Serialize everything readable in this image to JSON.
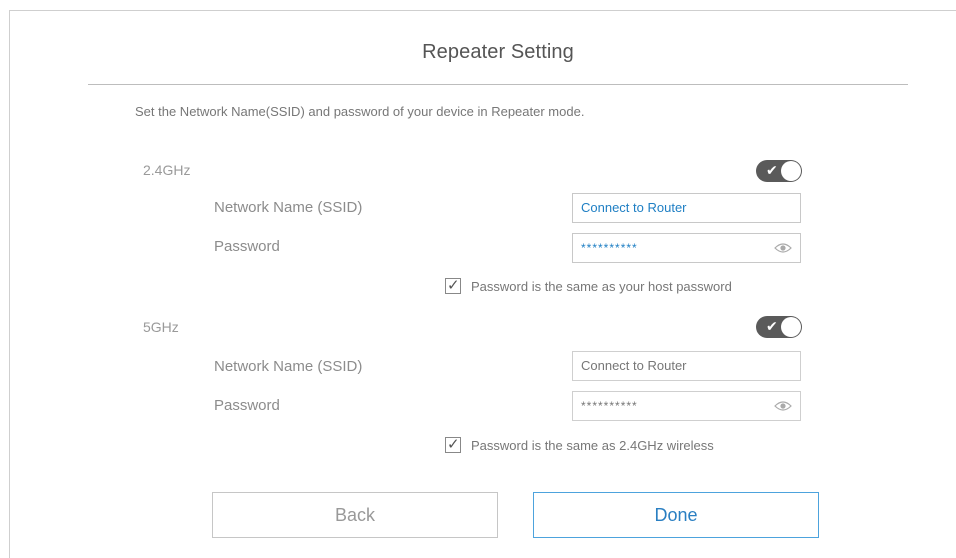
{
  "title": "Repeater Setting",
  "description": "Set the Network  Name(SSID) and password of your device in Repeater mode.",
  "bands": [
    {
      "name": "2.4GHz",
      "enabled": true,
      "ssid_label": "Network Name (SSID)",
      "ssid_value": "Connect to Router",
      "password_label": "Password",
      "password_value": "**********",
      "same_password_label": "Password is the same as your host password",
      "same_password_checked": true
    },
    {
      "name": "5GHz",
      "enabled": true,
      "ssid_label": "Network Name (SSID)",
      "ssid_value": "Connect to Router",
      "password_label": "Password",
      "password_value": "**********",
      "same_password_label": "Password is the same as 2.4GHz wireless",
      "same_password_checked": true
    }
  ],
  "buttons": {
    "back": "Back",
    "done": "Done"
  },
  "colors": {
    "accent": "#2a7fc2",
    "toggle_on": "#5a5a5a"
  },
  "icons": [
    "check-icon",
    "eye-icon"
  ]
}
